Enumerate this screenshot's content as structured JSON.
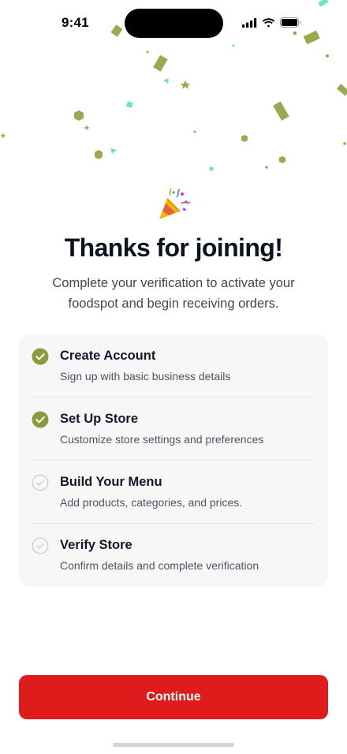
{
  "status_bar": {
    "time": "9:41"
  },
  "header": {
    "icon": "party-popper-icon",
    "title": "Thanks for joining!",
    "subtitle": "Complete your verification to activate your foodspot and begin receiving orders."
  },
  "steps": [
    {
      "title": "Create Account",
      "description": "Sign up with basic business details",
      "done": true
    },
    {
      "title": "Set Up Store",
      "description": "Customize store settings and preferences",
      "done": true
    },
    {
      "title": "Build Your Menu",
      "description": "Add products, categories, and prices.",
      "done": false
    },
    {
      "title": "Verify Store",
      "description": "Confirm details and complete verification",
      "done": false
    }
  ],
  "actions": {
    "continue_label": "Continue"
  },
  "colors": {
    "primary": "#e01b1b",
    "check_done": "#8a9a3f",
    "check_pending": "#cfcfcf",
    "card_bg": "#f7f7f7",
    "confetti_olive": "#9aa84e",
    "confetti_mint": "#6ee7b7"
  }
}
